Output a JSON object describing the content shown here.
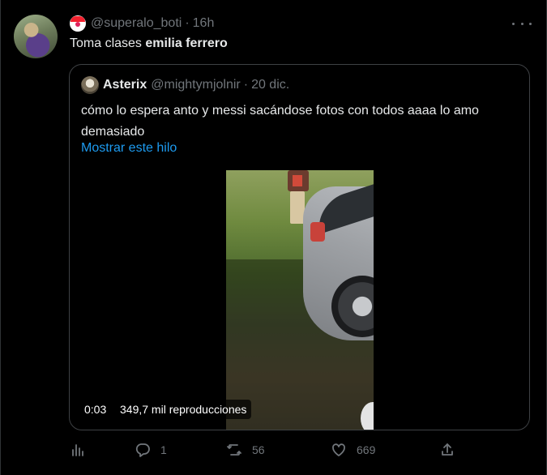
{
  "tweet": {
    "handle": "@superalo_boti",
    "separator": "·",
    "time": "16h",
    "text_prefix": "Toma clases ",
    "text_bold": "emilia ferrero"
  },
  "quote": {
    "name": "Asterix",
    "handle": "@mightymjolnir",
    "separator": "·",
    "date": "20 dic.",
    "text": "cómo lo espera anto y messi sacándose fotos con todos aaaa lo amo demasiado",
    "show_thread": "Mostrar este hilo",
    "video": {
      "duration": "0:03",
      "views": "349,7 mil reproducciones"
    }
  },
  "actions": {
    "analytics_icon": "analytics-icon",
    "reply_icon": "reply-icon",
    "reply_count": "1",
    "retweet_icon": "retweet-icon",
    "retweet_count": "56",
    "like_icon": "heart-icon",
    "like_count": "669",
    "share_icon": "share-icon"
  },
  "colors": {
    "background": "#000000",
    "text": "#e7e9ea",
    "muted": "#71767b",
    "link": "#1d9bf0",
    "border": "#2f3336"
  }
}
